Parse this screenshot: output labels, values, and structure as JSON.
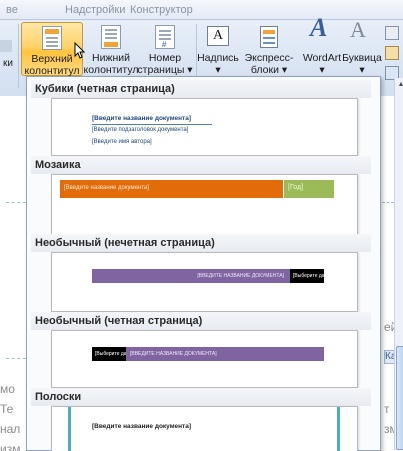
{
  "ribbon": {
    "tabs": [
      "Надстройки",
      "Конструктор"
    ],
    "buttons": {
      "header": {
        "line1": "Верхний",
        "line2": "колонтитул ▾"
      },
      "footer": {
        "line1": "Нижний",
        "line2": "колонтитул ▾"
      },
      "page_number": {
        "line1": "Номер",
        "line2": "страницы ▾"
      },
      "textbox": "Надпись ▾",
      "quick_parts": "Экспресс-блоки ▾",
      "wordart": "WordArt ▾",
      "dropcap": "Буквица ▾"
    }
  },
  "background": {
    "left_chars": [
      "мо",
      "Те",
      "нал",
      "изм"
    ],
    "right_chars": [
      "ей",
      "Кас",
      "т",
      "зм"
    ]
  },
  "gallery": {
    "sections": [
      {
        "title": "Кубики (четная страница)"
      },
      {
        "title": "Мозаика"
      },
      {
        "title": "Необычный (нечетная страница)"
      },
      {
        "title": "Необычный (четная страница)"
      },
      {
        "title": "Полоски"
      }
    ],
    "cubes": {
      "title": "[Введите название документа]",
      "subtitle": "[Введите подзаголовок документа]",
      "author": "[Введите имя автора]"
    },
    "mosaic": {
      "title": "[Введите название документа]",
      "year": "[Год]"
    },
    "odd": {
      "title": "[ВВЕДИТЕ НАЗВАНИЕ ДОКУМЕНТА]",
      "date": "[Выберите дату]"
    },
    "even": {
      "title": "[ВВЕДИТЕ НАЗВАНИЕ ДОКУМЕНТА]",
      "date": "[Выберите дату]"
    },
    "stripes": {
      "title": "[Введите название документа]"
    }
  },
  "colors": {
    "accent_orange": "#e36c0a",
    "accent_green": "#9bbb59",
    "accent_purple": "#8064a2",
    "accent_teal": "#4bacc6",
    "text_blue": "#1f497d"
  }
}
